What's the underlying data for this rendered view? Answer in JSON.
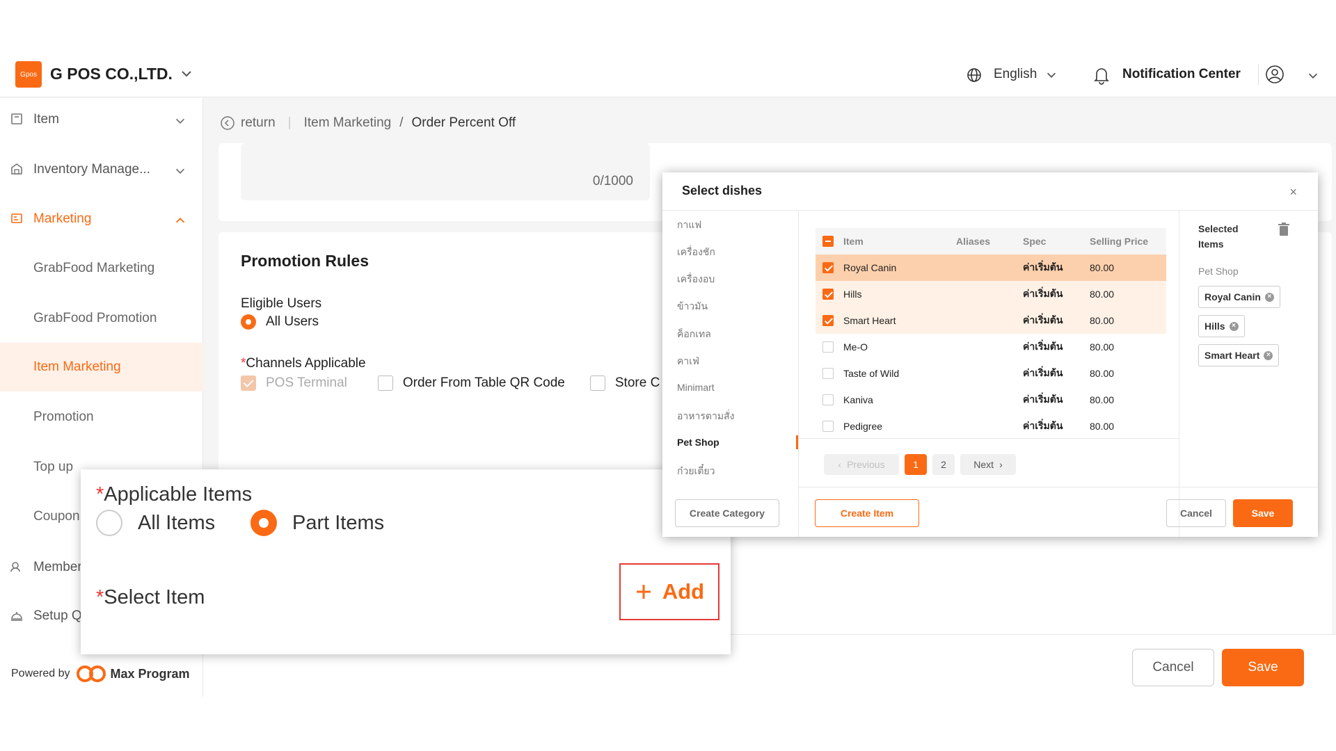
{
  "header": {
    "logo_text": "Gpos",
    "company": "G POS CO.,LTD.",
    "language": "English",
    "notification": "Notification Center"
  },
  "sidebar": {
    "items": [
      {
        "label": "Item"
      },
      {
        "label": "Inventory Manage..."
      },
      {
        "label": "Marketing"
      },
      {
        "label": "GrabFood Marketing"
      },
      {
        "label": "GrabFood Promotion"
      },
      {
        "label": "Item Marketing"
      },
      {
        "label": "Promotion"
      },
      {
        "label": "Top up"
      },
      {
        "label": "Coupon"
      },
      {
        "label": "Member"
      },
      {
        "label": "Setup QR Order"
      }
    ],
    "powered_by": "Powered by",
    "brand": "Max Program"
  },
  "breadcrumb": {
    "return": "return",
    "parent": "Item Marketing",
    "separator": "/",
    "current": "Order Percent Off"
  },
  "description": {
    "counter": "0/1000"
  },
  "promotion_rules": {
    "title": "Promotion Rules",
    "eligible_users_label": "Eligible Users",
    "eligible_users_value": "All Users",
    "channels_label": "Channels Applicable",
    "channels": [
      "POS Terminal",
      "Order From Table QR Code",
      "Store C"
    ]
  },
  "zoom_callout": {
    "applicable_items_label": "Applicable Items",
    "option_all": "All Items",
    "option_part": "Part Items",
    "select_item_label": "Select Item",
    "add_label": "Add"
  },
  "footer": {
    "cancel": "Cancel",
    "save": "Save"
  },
  "dialog": {
    "title": "Select dishes",
    "close": "×",
    "categories": [
      "กาแฟ",
      "เครื่องชัก",
      "เครื่องอบ",
      "ข้าวมัน",
      "ค็อกเทล",
      "คาเฟ่",
      "Minimart",
      "อาหารตามสั่ง",
      "Pet Shop",
      "ก๋วยเตี๋ยว"
    ],
    "active_category": "Pet Shop",
    "columns": [
      "Item",
      "Aliases",
      "Spec",
      "Selling Price"
    ],
    "rows": [
      {
        "item": "Royal Canin",
        "aliases": "",
        "spec": "ค่าเริ่มต้น",
        "price": "80.00",
        "checked": true
      },
      {
        "item": "Hills",
        "aliases": "",
        "spec": "ค่าเริ่มต้น",
        "price": "80.00",
        "checked": true
      },
      {
        "item": "Smart Heart",
        "aliases": "",
        "spec": "ค่าเริ่มต้น",
        "price": "80.00",
        "checked": true
      },
      {
        "item": "Me-O",
        "aliases": "",
        "spec": "ค่าเริ่มต้น",
        "price": "80.00",
        "checked": false
      },
      {
        "item": "Taste of Wild",
        "aliases": "",
        "spec": "ค่าเริ่มต้น",
        "price": "80.00",
        "checked": false
      },
      {
        "item": "Kaniva",
        "aliases": "",
        "spec": "ค่าเริ่มต้น",
        "price": "80.00",
        "checked": false
      },
      {
        "item": "Pedigree",
        "aliases": "",
        "spec": "ค่าเริ่มต้น",
        "price": "80.00",
        "checked": false
      }
    ],
    "pagination": {
      "previous": "Previous",
      "pages": [
        "1",
        "2"
      ],
      "current": "1",
      "next": "Next"
    },
    "selected_title": "Selected Items",
    "selected_group": "Pet Shop",
    "selected_tags": [
      "Royal Canin",
      "Hills",
      "Smart Heart"
    ],
    "create_category": "Create Category",
    "create_item": "Create Item",
    "cancel": "Cancel",
    "save": "Save"
  },
  "colors": {
    "accent": "#fa6a14",
    "required": "#e53935"
  }
}
